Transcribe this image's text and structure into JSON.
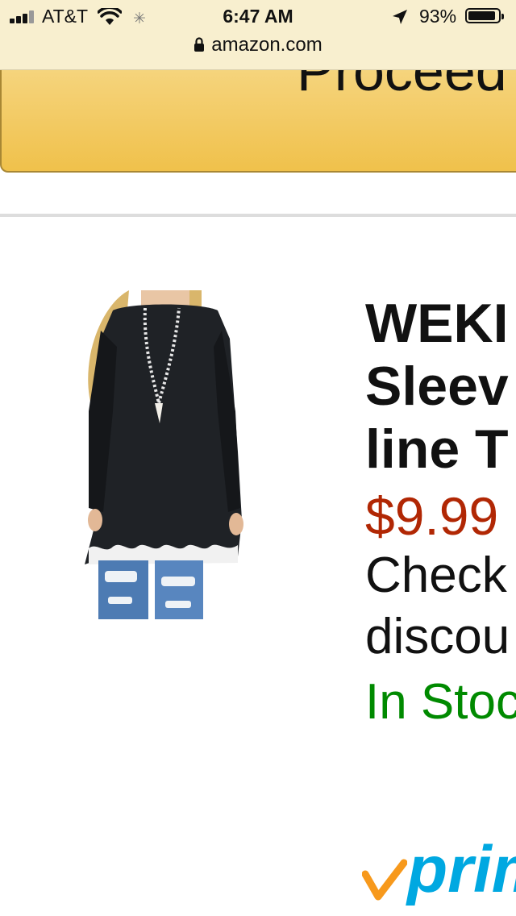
{
  "status_bar": {
    "carrier": "AT&T",
    "time": "6:47 AM",
    "battery": "93%",
    "battery_level": 0.93,
    "icons": [
      "signal-icon",
      "wifi-icon",
      "loading-spinner-icon",
      "location-arrow-icon",
      "battery-icon"
    ]
  },
  "browser": {
    "url": "amazon.com",
    "lock_icon": "lock-icon"
  },
  "cart": {
    "proceed_label": "Proceed"
  },
  "product": {
    "image_icon": "product-photo",
    "title_lines": [
      "WEKI",
      "Sleev",
      "line T"
    ],
    "price": "$9.99",
    "promo_lines": [
      "Check",
      "discou"
    ],
    "stock": "In Stoc",
    "prime": "prim",
    "prime_check_icon": "prime-check-icon"
  },
  "colors": {
    "button": "#f0c14b",
    "button_border": "#a88734",
    "price": "#b12704",
    "stock": "#008a00",
    "prime_blue": "#00a8e1",
    "prime_orange": "#f7991c",
    "url_bar": "#f8efcf"
  }
}
